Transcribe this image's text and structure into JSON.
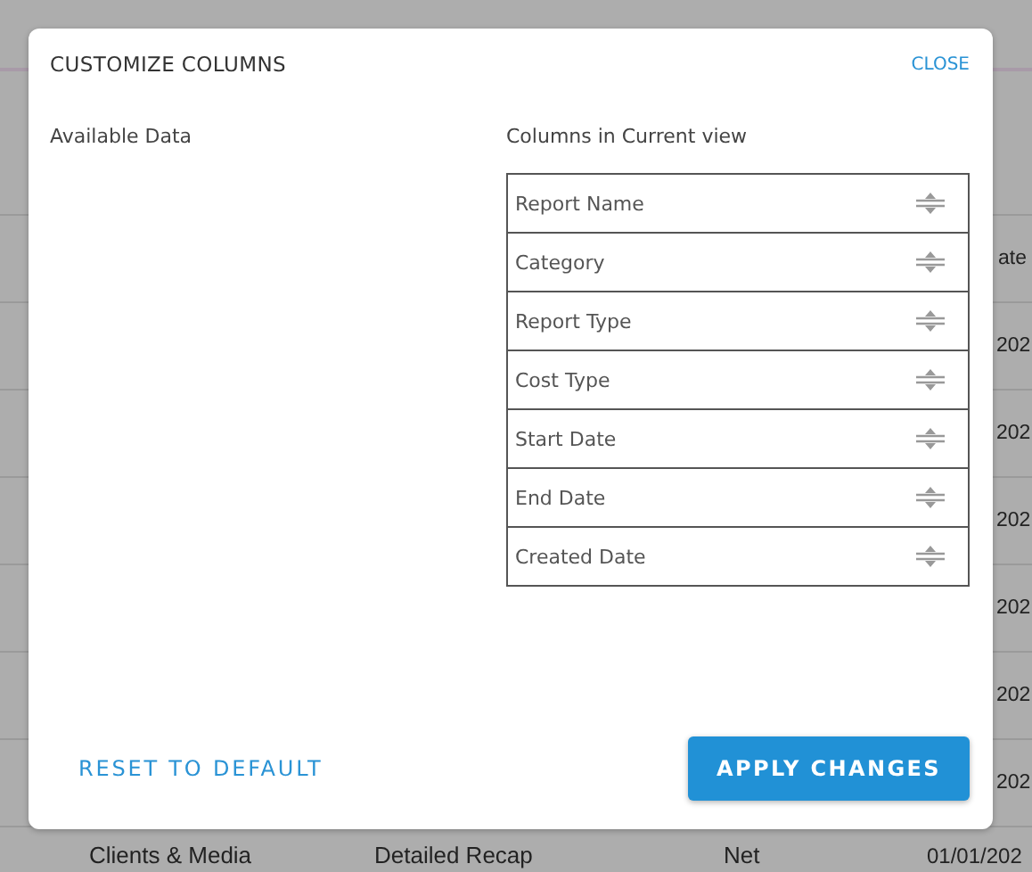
{
  "background_table": {
    "header": {
      "column_4": "ate"
    },
    "rows": [
      {
        "column_4": "202"
      },
      {
        "column_4": "202"
      },
      {
        "column_4": "202"
      },
      {
        "column_4": "202"
      },
      {
        "column_4": "202"
      },
      {
        "column_4": "202"
      },
      {
        "column_1": "Clients & Media",
        "column_2": "Detailed Recap",
        "column_3": "Net",
        "column_4": "01/01/202"
      }
    ]
  },
  "dialog": {
    "title": "CUSTOMIZE COLUMNS",
    "close": "CLOSE",
    "available_heading": "Available Data",
    "current_heading": "Columns in Current view",
    "current_columns": [
      {
        "label": "Report Name"
      },
      {
        "label": "Category"
      },
      {
        "label": "Report Type"
      },
      {
        "label": "Cost Type"
      },
      {
        "label": "Start Date"
      },
      {
        "label": "End Date"
      },
      {
        "label": "Created Date"
      }
    ],
    "buttons": {
      "reset": "RESET TO DEFAULT",
      "apply": "APPLY CHANGES"
    }
  }
}
